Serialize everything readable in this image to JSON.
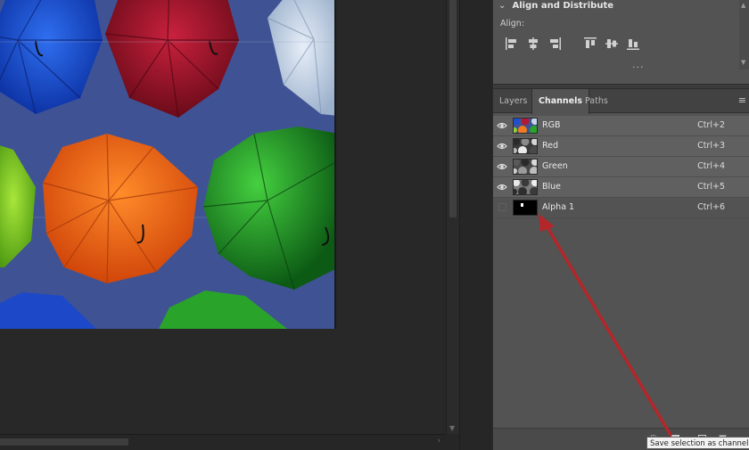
{
  "align_panel": {
    "title": "Align and Distribute",
    "align_label": "Align:",
    "more": "..."
  },
  "tabs": [
    {
      "label": "Layers",
      "active": false
    },
    {
      "label": "Channels",
      "active": true
    },
    {
      "label": "Paths",
      "active": false
    }
  ],
  "channels": [
    {
      "name": "RGB",
      "shortcut": "Ctrl+2",
      "visible": true
    },
    {
      "name": "Red",
      "shortcut": "Ctrl+3",
      "visible": true
    },
    {
      "name": "Green",
      "shortcut": "Ctrl+4",
      "visible": true
    },
    {
      "name": "Blue",
      "shortcut": "Ctrl+5",
      "visible": true
    },
    {
      "name": "Alpha 1",
      "shortcut": "Ctrl+6",
      "visible": false
    }
  ],
  "tooltip": "Save selection as channel",
  "colors": {
    "sky": "#3f5394",
    "annotation_arrow": "#b3262a",
    "panel_bg": "#535353"
  }
}
